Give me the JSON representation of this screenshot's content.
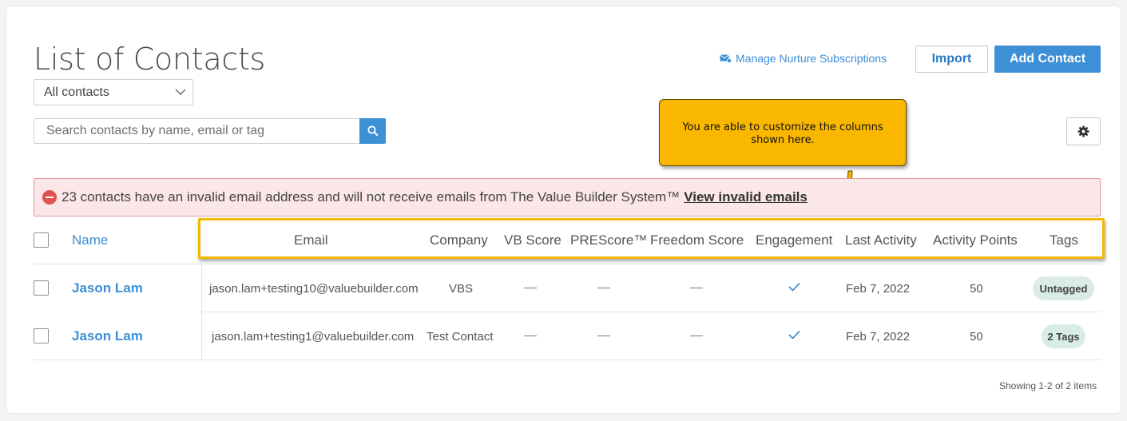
{
  "page": {
    "title": "List of Contacts",
    "filter_selected": "All contacts",
    "search_placeholder": "Search contacts by name, email or tag"
  },
  "toolbar": {
    "nurture_label": "Manage Nurture Subscriptions",
    "import_label": "Import",
    "add_label": "Add Contact"
  },
  "callout": {
    "text": "You are able to customize the columns shown here."
  },
  "alert": {
    "message": "23 contacts have an invalid email address and will not receive emails from The Value Builder System™",
    "link": "View invalid emails"
  },
  "table": {
    "columns": [
      "Name",
      "Email",
      "Company",
      "VB Score",
      "PREScore™",
      "Freedom Score",
      "Engagement",
      "Last Activity",
      "Activity Points",
      "Tags"
    ],
    "rows": [
      {
        "name": "Jason Lam",
        "email": "jason.lam+testing10@valuebuilder.com",
        "company": "VBS",
        "vb_score": "—",
        "prescore": "—",
        "freedom_score": "—",
        "engagement": "check-icon",
        "last_activity": "Feb 7, 2022",
        "activity_points": "50",
        "tags": "Untagged"
      },
      {
        "name": "Jason Lam",
        "email": "jason.lam+testing1@valuebuilder.com",
        "company": "Test Contact",
        "vb_score": "—",
        "prescore": "—",
        "freedom_score": "—",
        "engagement": "check-icon",
        "last_activity": "Feb 7, 2022",
        "activity_points": "50",
        "tags": "2 Tags"
      }
    ]
  },
  "footer": {
    "showing": "Showing 1-2 of 2 items"
  },
  "colors": {
    "accent": "#3d8fd6",
    "callout": "#f9b700",
    "highlight_border": "#f5b800",
    "alert_bg": "#fbe7e7",
    "tag_bg": "#d9ece8"
  }
}
